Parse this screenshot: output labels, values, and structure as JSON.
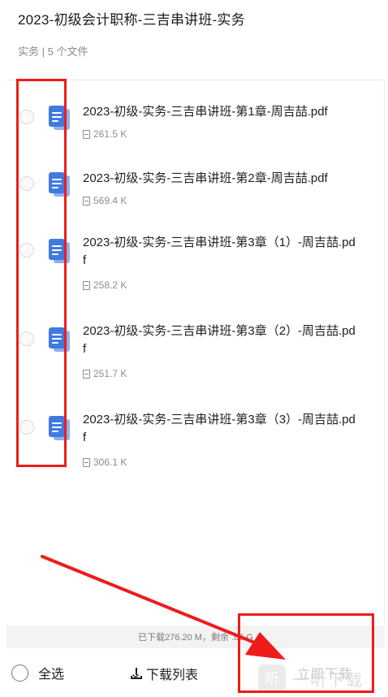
{
  "header": {
    "title": "2023-初级会计职称-三吉串讲班-实务",
    "subtitle": "实务 | 5 个文件"
  },
  "files": [
    {
      "name": "2023-初级-实务-三吉串讲班-第1章-周吉喆.pdf",
      "size": "261.5 K",
      "icon": "document-icon"
    },
    {
      "name": "2023-初级-实务-三吉串讲班-第2章-周吉喆.pdf",
      "size": "569.4 K",
      "icon": "document-icon"
    },
    {
      "name": "2023-初级-实务-三吉串讲班-第3章（1）-周吉喆.pdf",
      "size": "258.2 K",
      "icon": "document-icon"
    },
    {
      "name": "2023-初级-实务-三吉串讲班-第3章（2）-周吉喆.pdf",
      "size": "251.7 K",
      "icon": "document-icon"
    },
    {
      "name": "2023-初级-实务-三吉串讲班-第3章（3）-周吉喆.pdf",
      "size": "306.1 K",
      "icon": "document-icon"
    }
  ],
  "status": {
    "text": "已下载276.20 M，剩余 .86 G"
  },
  "bottom": {
    "select_all": "全选",
    "download_list": "下载列表",
    "download_now": "立即下载"
  },
  "watermark": {
    "logo": "听",
    "text": "一听下载"
  },
  "colors": {
    "annotation_red": "#ef1b1b",
    "file_icon_blue": "#3f7ae0",
    "disabled_text": "#c9c9c9"
  }
}
